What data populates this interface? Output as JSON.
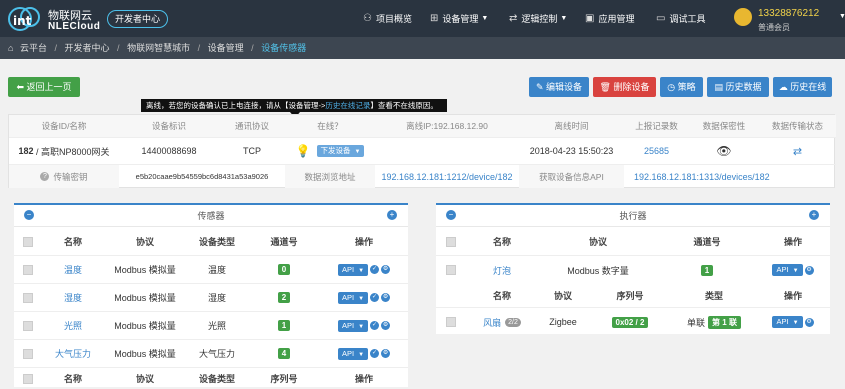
{
  "header": {
    "logo_cn": "物联网云",
    "logo_en": "NLECloud",
    "dev_center": "开发者中心",
    "nav": [
      {
        "label": "项目概览",
        "icon": "hierarchy-icon",
        "glyph": "⚇"
      },
      {
        "label": "设备管理",
        "icon": "grid-icon",
        "glyph": "⊞",
        "caret": true
      },
      {
        "label": "逻辑控制",
        "icon": "shuffle-icon",
        "glyph": "⇄",
        "caret": true
      },
      {
        "label": "应用管理",
        "icon": "app-icon",
        "glyph": "▣"
      },
      {
        "label": "调试工具",
        "icon": "monitor-icon",
        "glyph": "▭"
      }
    ],
    "user": {
      "name": "13328876212",
      "level": "普通会员"
    }
  },
  "breadcrumb": [
    "云平台",
    "开发者中心",
    "物联网智慧城市",
    "设备管理",
    "设备传感器"
  ],
  "actions": {
    "back": "返回上一页",
    "edit": "编辑设备",
    "delete": "删除设备",
    "strategy": "策略",
    "history_data": "历史数据",
    "history_online": "历史在线"
  },
  "tooltip": {
    "pre": "离线，若您的设备确认已上电连接，请从【设备管理->",
    "link": "历史在线记录",
    "post": "】查看不在线原因。"
  },
  "device": {
    "headers": [
      "设备ID/名称",
      "设备标识",
      "通讯协议",
      "在线？",
      "离线IP:192.168.12.90",
      "离线时间",
      "上报记录数",
      "数据保密性",
      "数据传输状态"
    ],
    "id": "182",
    "name": "/ 高职NP8000网关",
    "tag": "14400088698",
    "protocol": "TCP",
    "send_label": "下发设备",
    "offline_time": "2018-04-23 15:50:23",
    "records": "25685",
    "secret_label": "传输密钥",
    "secret_value": "e5b20caae9b54559bc6d8431a53a9026",
    "browse_label": "数据浏览地址",
    "browse_url": "192.168.12.181:1212/device/182",
    "api_label": "获取设备信息API",
    "api_url": "192.168.12.181:1313/devices/182"
  },
  "sensors": {
    "title": "传感器",
    "headers": [
      "名称",
      "协议",
      "设备类型",
      "通道号",
      "操作"
    ],
    "rows": [
      {
        "name": "温度",
        "protocol": "Modbus 模拟量",
        "type": "温度",
        "channel": "0",
        "api": "API"
      },
      {
        "name": "湿度",
        "protocol": "Modbus 模拟量",
        "type": "湿度",
        "channel": "2",
        "api": "API"
      },
      {
        "name": "光照",
        "protocol": "Modbus 模拟量",
        "type": "光照",
        "channel": "1",
        "api": "API"
      },
      {
        "name": "大气压力",
        "protocol": "Modbus 模拟量",
        "type": "大气压力",
        "channel": "4",
        "api": "API"
      }
    ],
    "footer_headers": [
      "名称",
      "协议",
      "设备类型",
      "序列号",
      "操作"
    ]
  },
  "actuators": {
    "title": "执行器",
    "headers": [
      "名称",
      "协议",
      "通道号",
      "操作"
    ],
    "rows": [
      {
        "name": "灯泡",
        "protocol": "Modbus 数字量",
        "channel": "1",
        "api": "API"
      }
    ],
    "headers2": [
      "名称",
      "协议",
      "序列号",
      "类型",
      "操作"
    ],
    "rows2": [
      {
        "name": "风扇",
        "count": "2/2",
        "protocol": "Zigbee",
        "serial": "0x02 / 2",
        "type": "单联",
        "type_badge": "第 1 联",
        "api": "API"
      }
    ]
  }
}
